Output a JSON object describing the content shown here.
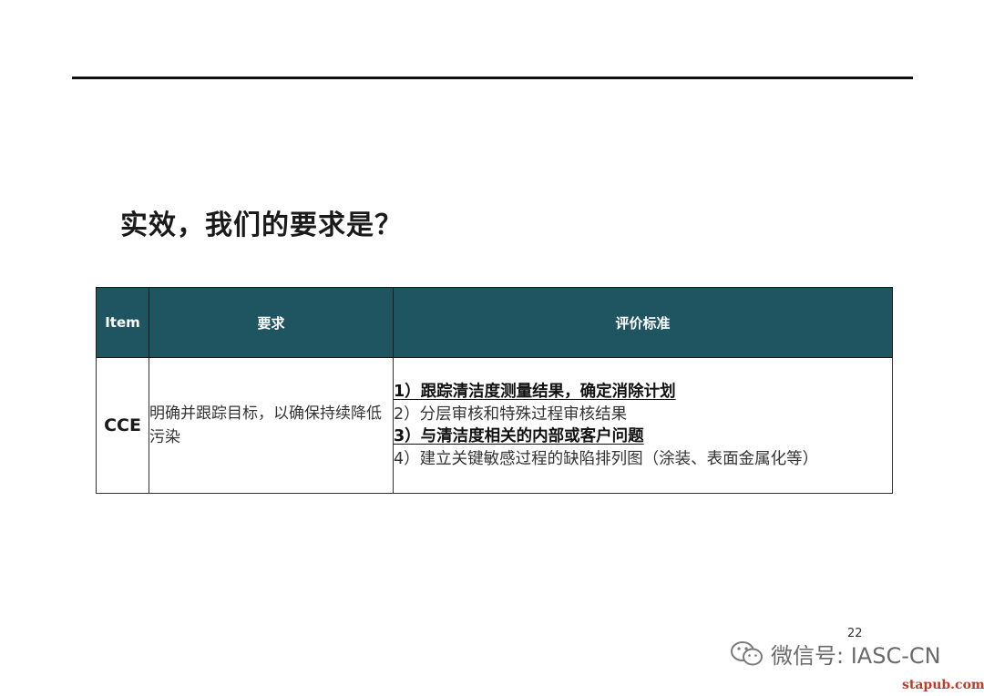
{
  "slide": {
    "title": "实效，我们的要求是？",
    "page_number": "22"
  },
  "table": {
    "headers": [
      "Item",
      "要求",
      "评价标准"
    ],
    "rows": [
      {
        "item": "CCE",
        "requirement": "明确并跟踪目标，以确保持续降低污染",
        "criteria": [
          {
            "text": "1）跟踪清洁度测量结果，确定消除计划",
            "emphasis": true
          },
          {
            "text": "2）分层审核和特殊过程审核结果",
            "emphasis": false
          },
          {
            "text": "3）与清洁度相关的内部或客户问题",
            "emphasis": true
          },
          {
            "text": "4）建立关键敏感过程的缺陷排列图（涂装、表面金属化等）",
            "emphasis": false
          }
        ]
      }
    ]
  },
  "watermark": {
    "icon": "wechat-icon",
    "text": "微信号: IASC-CN"
  },
  "site_mark": "stapub.com",
  "colors": {
    "header_bg": "#1f5560",
    "rule": "#111111",
    "watermark": "#6a6a6a",
    "site_mark": "#c0392b"
  }
}
